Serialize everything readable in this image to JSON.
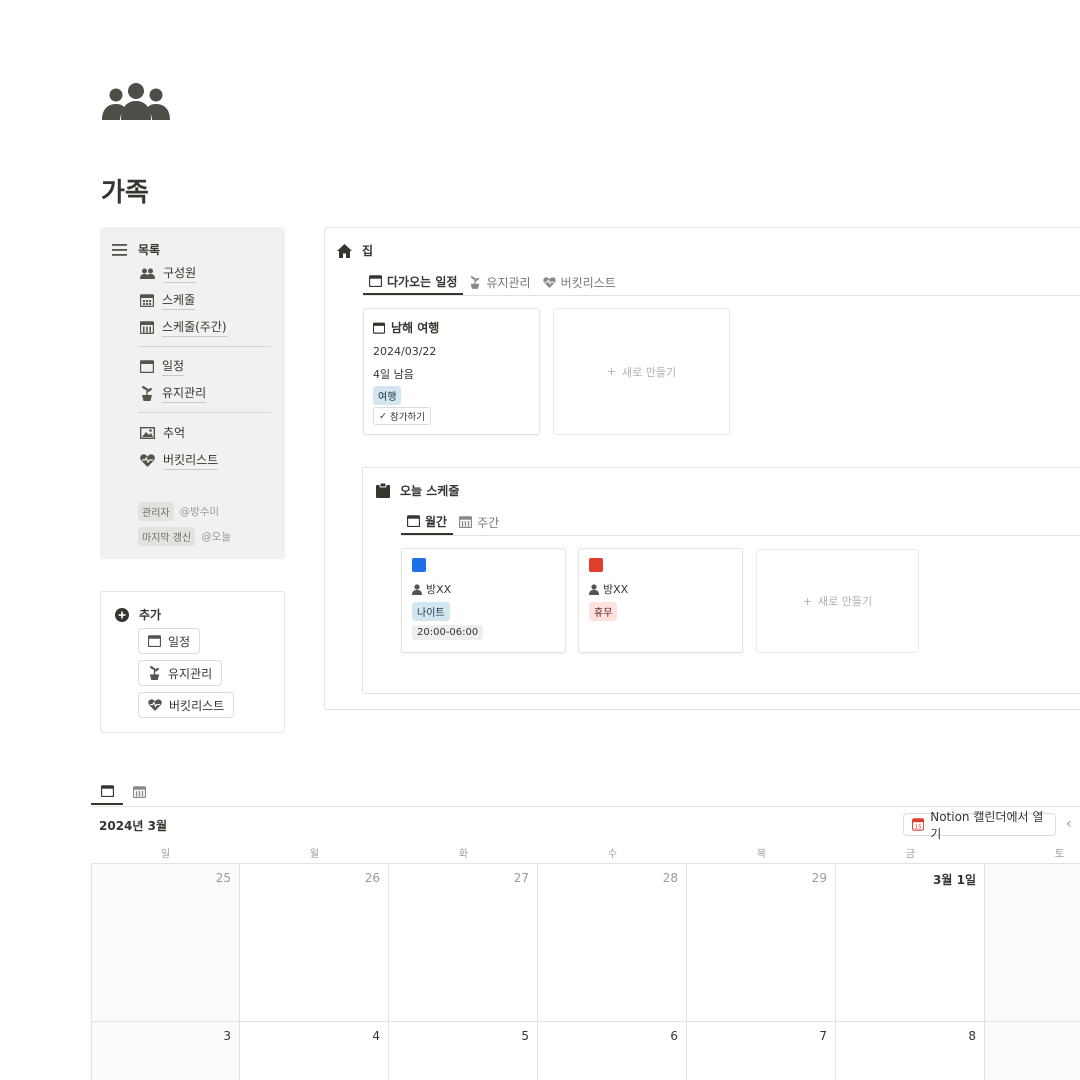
{
  "page": {
    "title": "가족",
    "icon": "family-icon"
  },
  "nav": {
    "heading": "목록",
    "items": [
      {
        "label": "구성원",
        "icon": "people-icon"
      },
      {
        "label": "스케줄",
        "icon": "calendar-grid-icon"
      },
      {
        "label": "스케줄(주간)",
        "icon": "calendar-week-icon"
      },
      {
        "label": "일정",
        "icon": "calendar-icon"
      },
      {
        "label": "유지관리",
        "icon": "plant-icon"
      },
      {
        "label": "추억",
        "icon": "image-icon"
      },
      {
        "label": "버킷리스트",
        "icon": "heart-pulse-icon"
      }
    ],
    "meta": [
      {
        "tag": "관리자",
        "value": "@방수미"
      },
      {
        "tag": "마지막 갱신",
        "value": "@오늘"
      }
    ]
  },
  "add": {
    "heading": "추가",
    "buttons": [
      "일정",
      "유지관리",
      "버킷리스트"
    ]
  },
  "home": {
    "heading": "집",
    "tabs": [
      "다가오는 일정",
      "유지관리",
      "버킷리스트"
    ],
    "event_card": {
      "title": "남해 여행",
      "date": "2024/03/22",
      "remaining": "4일 남음",
      "tag": "여행",
      "button": "참가하기"
    },
    "new_label": "새로 만들기"
  },
  "today": {
    "heading": "오늘 스케줄",
    "tabs": [
      "월간",
      "주간"
    ],
    "cards": [
      {
        "name": "방XX",
        "tag": "나이트",
        "time": "20:00-06:00",
        "color": "#1f6fe8"
      },
      {
        "name": "방XX",
        "tag": "휴무",
        "time": "",
        "color": "#e03e2d"
      }
    ],
    "new_label": "새로 만들기"
  },
  "calendar": {
    "month": "2024년 3월",
    "open_button": "Notion 캘린더에서 열기",
    "weekdays": [
      "일",
      "월",
      "화",
      "수",
      "목",
      "금",
      "토"
    ],
    "week1": [
      "25",
      "26",
      "27",
      "28",
      "29",
      "3월 1일",
      ""
    ],
    "week2": [
      "3",
      "4",
      "5",
      "6",
      "7",
      "8",
      ""
    ]
  },
  "colors": {
    "text": "#37352f",
    "sidebar_bg": "#f1f1ef",
    "border": "#e3e2de"
  }
}
